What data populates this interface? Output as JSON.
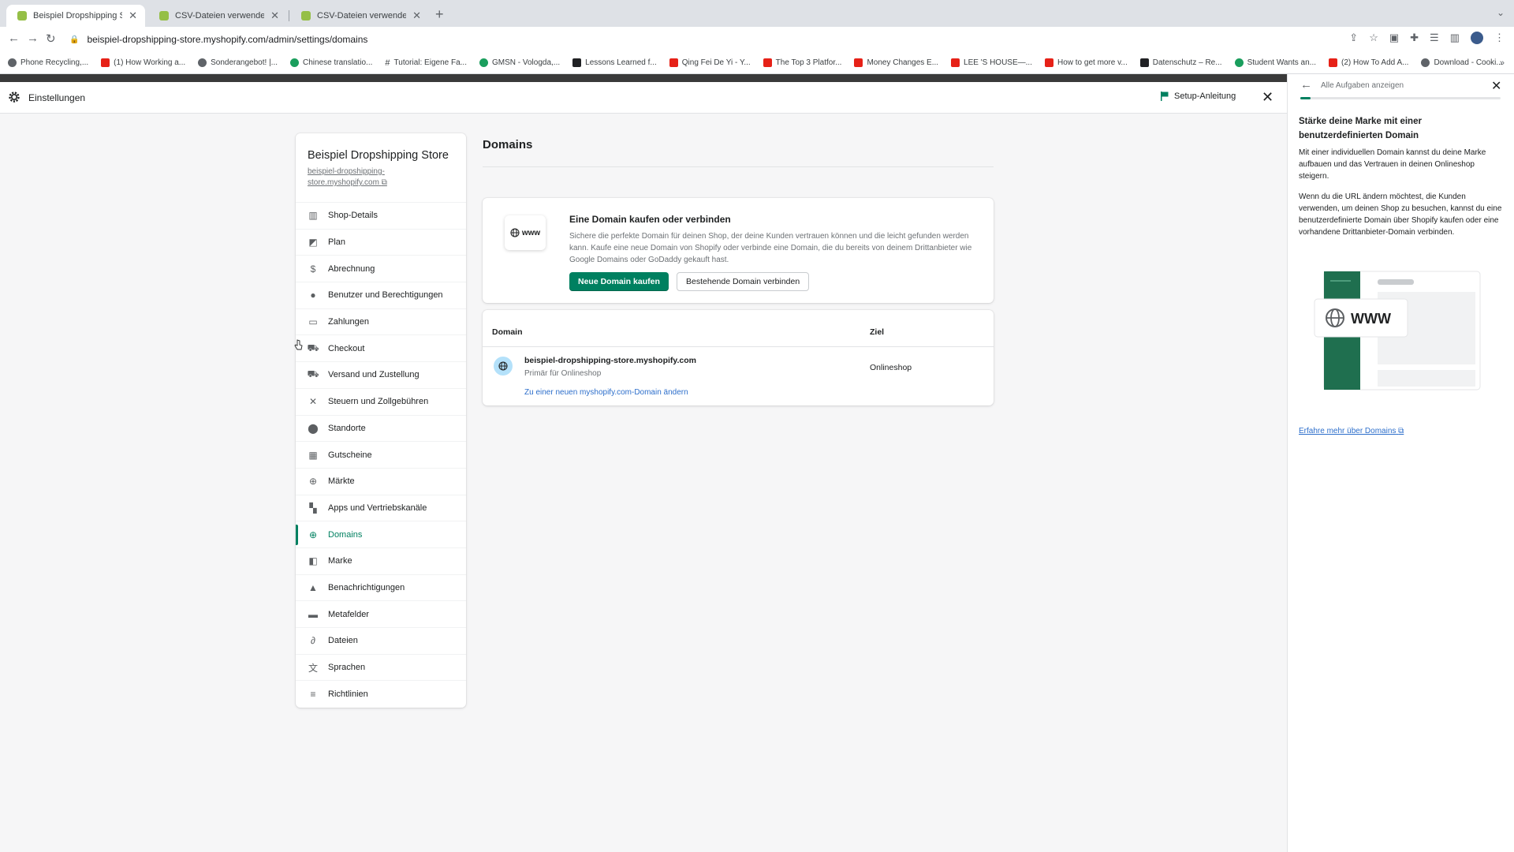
{
  "browser": {
    "tabs": [
      {
        "title": "Beispiel Dropshipping Store · S",
        "active": true
      },
      {
        "title": "CSV-Dateien verwenden, um P",
        "active": false
      },
      {
        "title": "CSV-Dateien verwenden, um P",
        "active": false
      }
    ],
    "url": "beispiel-dropshipping-store.myshopify.com/admin/settings/domains",
    "bookmarks": [
      {
        "label": "Phone Recycling,...",
        "icon": "o-icon"
      },
      {
        "label": "(1) How Working a...",
        "icon": "youtube-icon"
      },
      {
        "label": "Sonderangebot! |...",
        "icon": "globe-icon"
      },
      {
        "label": "Chinese translatio...",
        "icon": "green-circle-icon"
      },
      {
        "label": "Tutorial: Eigene Fa...",
        "icon": "hash-icon"
      },
      {
        "label": "GMSN - Vologda,...",
        "icon": "green-circle-icon"
      },
      {
        "label": "Lessons Learned f...",
        "icon": "er-icon"
      },
      {
        "label": "Qing Fei De Yi - Y...",
        "icon": "youtube-icon"
      },
      {
        "label": "The Top 3 Platfor...",
        "icon": "youtube-icon"
      },
      {
        "label": "Money Changes E...",
        "icon": "youtube-icon"
      },
      {
        "label": "LEE 'S HOUSE—...",
        "icon": "airbnb-icon"
      },
      {
        "label": "How to get more v...",
        "icon": "youtube-icon"
      },
      {
        "label": "Datenschutz – Re...",
        "icon": "dark-icon"
      },
      {
        "label": "Student Wants an...",
        "icon": "green-circle-icon"
      },
      {
        "label": "(2) How To Add A...",
        "icon": "youtube-icon"
      },
      {
        "label": "Download - Cooki...",
        "icon": "cookie-icon"
      }
    ]
  },
  "settings": {
    "title": "Einstellungen",
    "setup_label": "Setup-Anleitung"
  },
  "store": {
    "name": "Beispiel Dropshipping Store",
    "link": "beispiel-dropshipping-store.myshopify.com"
  },
  "nav": [
    {
      "label": "Shop-Details",
      "icon": "store-icon",
      "active": false
    },
    {
      "label": "Plan",
      "icon": "plan-icon",
      "active": false
    },
    {
      "label": "Abrechnung",
      "icon": "billing-icon",
      "active": false
    },
    {
      "label": "Benutzer und Berechtigungen",
      "icon": "user-icon",
      "active": false
    },
    {
      "label": "Zahlungen",
      "icon": "payments-icon",
      "active": false
    },
    {
      "label": "Checkout",
      "icon": "cart-icon",
      "active": false
    },
    {
      "label": "Versand und Zustellung",
      "icon": "truck-icon",
      "active": false
    },
    {
      "label": "Steuern und Zollgebühren",
      "icon": "tax-icon",
      "active": false
    },
    {
      "label": "Standorte",
      "icon": "location-icon",
      "active": false
    },
    {
      "label": "Gutscheine",
      "icon": "gift-icon",
      "active": false
    },
    {
      "label": "Märkte",
      "icon": "globe-icon",
      "active": false
    },
    {
      "label": "Apps und Vertriebskanäle",
      "icon": "apps-icon",
      "active": false
    },
    {
      "label": "Domains",
      "icon": "globe-icon",
      "active": true
    },
    {
      "label": "Marke",
      "icon": "brand-icon",
      "active": false
    },
    {
      "label": "Benachrichtigungen",
      "icon": "bell-icon",
      "active": false
    },
    {
      "label": "Metafelder",
      "icon": "metafields-icon",
      "active": false
    },
    {
      "label": "Dateien",
      "icon": "paperclip-icon",
      "active": false
    },
    {
      "label": "Sprachen",
      "icon": "translate-icon",
      "active": false
    },
    {
      "label": "Richtlinien",
      "icon": "policy-icon",
      "active": false
    }
  ],
  "main": {
    "title": "Domains",
    "promo": {
      "badge": "www",
      "title": "Eine Domain kaufen oder verbinden",
      "text": "Sichere die perfekte Domain für deinen Shop, der deine Kunden vertrauen können und die leicht gefunden werden kann. Kaufe eine neue Domain von Shopify oder verbinde eine Domain, die du bereits von deinem Drittanbieter wie Google Domains oder GoDaddy gekauft hast.",
      "primary_button": "Neue Domain kaufen",
      "secondary_button": "Bestehende Domain verbinden"
    },
    "table": {
      "col_domain": "Domain",
      "col_target": "Ziel",
      "row": {
        "domain": "beispiel-dropshipping-store.myshopify.com",
        "subtitle": "Primär für Onlineshop",
        "target": "Onlineshop",
        "change_link": "Zu einer neuen myshopify.com-Domain ändern"
      }
    }
  },
  "panel": {
    "back_label": "Alle Aufgaben anzeigen",
    "title": "Stärke deine Marke mit einer benutzerdefinierten Domain",
    "p1": "Mit einer individuellen Domain kannst du deine Marke aufbauen und das Vertrauen in deinen Onlineshop steigern.",
    "p2": "Wenn du die URL ändern möchtest, die Kunden verwenden, um deinen Shop zu besuchen, kannst du eine benutzerdefinierte Domain über Shopify kaufen oder eine vorhandene Drittanbieter-Domain verbinden.",
    "illustration_text": "WWW",
    "learn_more": "Erfahre mehr über Domains",
    "progress": 0.05
  },
  "colors": {
    "accent": "#008060",
    "link": "#2c6ecb",
    "active_nav": "#008060"
  }
}
